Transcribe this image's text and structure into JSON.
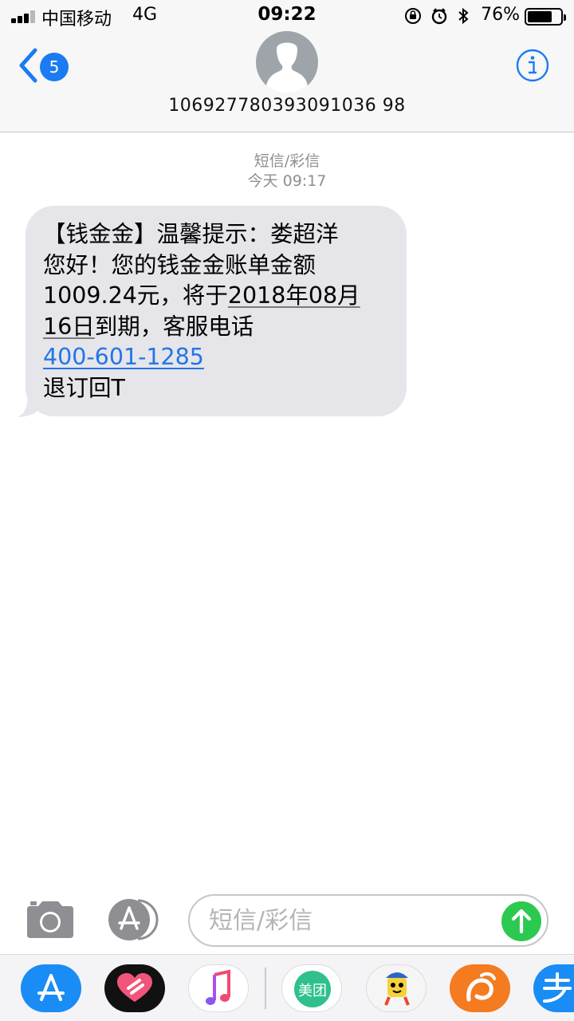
{
  "status_bar": {
    "carrier": "中国移动",
    "network": "4G",
    "time": "09:22",
    "battery_percent_text": "76%",
    "battery_level": 0.76
  },
  "nav": {
    "back_badge": "5",
    "contact_number": "106927780393091036 98",
    "info_icon": "info-icon"
  },
  "thread": {
    "service_label": "短信/彩信",
    "timestamp": "今天 09:17"
  },
  "message": {
    "line1": "【钱金金】温馨提示：娄超洋",
    "line2": "您好！您的钱金金账单金额",
    "line3_a": "1009.24元，将于",
    "line3_b": "2018年08月",
    "line4_a": "16日",
    "line4_b": "到期，客服电话",
    "phone": "400-601-1285",
    "line6": "退订回T"
  },
  "compose": {
    "placeholder": "短信/彩信",
    "camera_icon": "camera-icon",
    "apps_icon": "app-store-icon",
    "send_icon": "arrow-up-icon"
  },
  "drawer": {
    "apps": [
      {
        "name": "app-store",
        "color": "#1a8cf5"
      },
      {
        "name": "digital-touch",
        "color": "#111111"
      },
      {
        "name": "music",
        "color": "#ffffff"
      },
      {
        "name": "meituan",
        "label": "美团",
        "color": "#2fc08c"
      },
      {
        "name": "mascot-app",
        "color": "#f5f5f5"
      },
      {
        "name": "uc-browser",
        "color": "#f47b20"
      },
      {
        "name": "alipay",
        "color": "#1a8cf5"
      }
    ]
  },
  "colors": {
    "ios_blue": "#1a7bf2",
    "bubble_gray": "#e5e5ea",
    "send_green": "#2bc94f",
    "link_blue": "#2275e8"
  }
}
